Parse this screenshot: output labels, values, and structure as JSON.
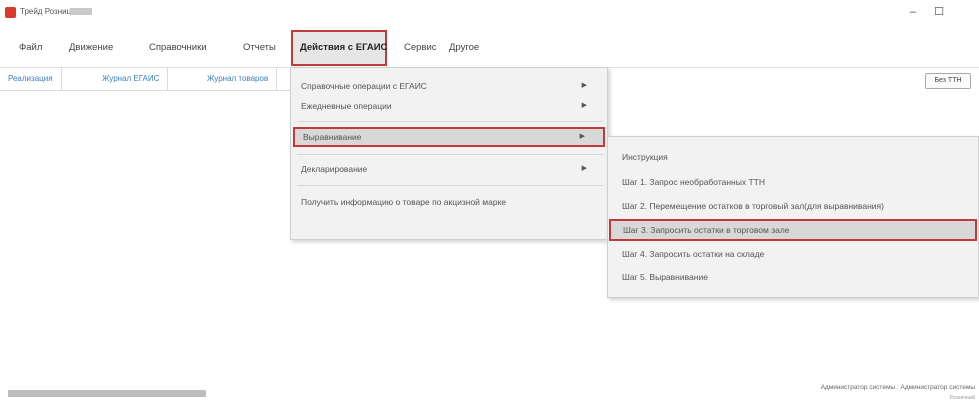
{
  "window": {
    "title": "Трейд Розница",
    "minimize": "–",
    "maximize": "☐"
  },
  "menubar": {
    "items": [
      "Файл",
      "Движение",
      "Справочники",
      "Отчеты",
      "Действия с ЕГАИС",
      "Сервис",
      "Другое"
    ]
  },
  "tabs": [
    "Реализация",
    "Журнал ЕГАИС",
    "Журнал товаров"
  ],
  "toolbar": {
    "ttn_button": "Без ТТН"
  },
  "dropdown": {
    "items": [
      "Справочные операции с ЕГАИС",
      "Ежедневные операции",
      "Выравнивание",
      "Декларирование",
      "Получить информацию о товаре по акцизной марке"
    ]
  },
  "submenu": {
    "items": [
      "Инструкция",
      "Шаг 1. Запрос необработанных ТТН",
      "Шаг 2. Перемещение остатков в торговый зал(для выравнивания)",
      "Шаг 3. Запросить остатки в торговом зале",
      "Шаг 4. Запросить остатки на складе",
      "Шаг 5. Выравнивание"
    ]
  },
  "status": {
    "user": "Администратор системы : Администратор системы",
    "extra": "Розничный"
  },
  "colors": {
    "highlight_border": "#c03a3a",
    "link": "#3b82c4"
  }
}
